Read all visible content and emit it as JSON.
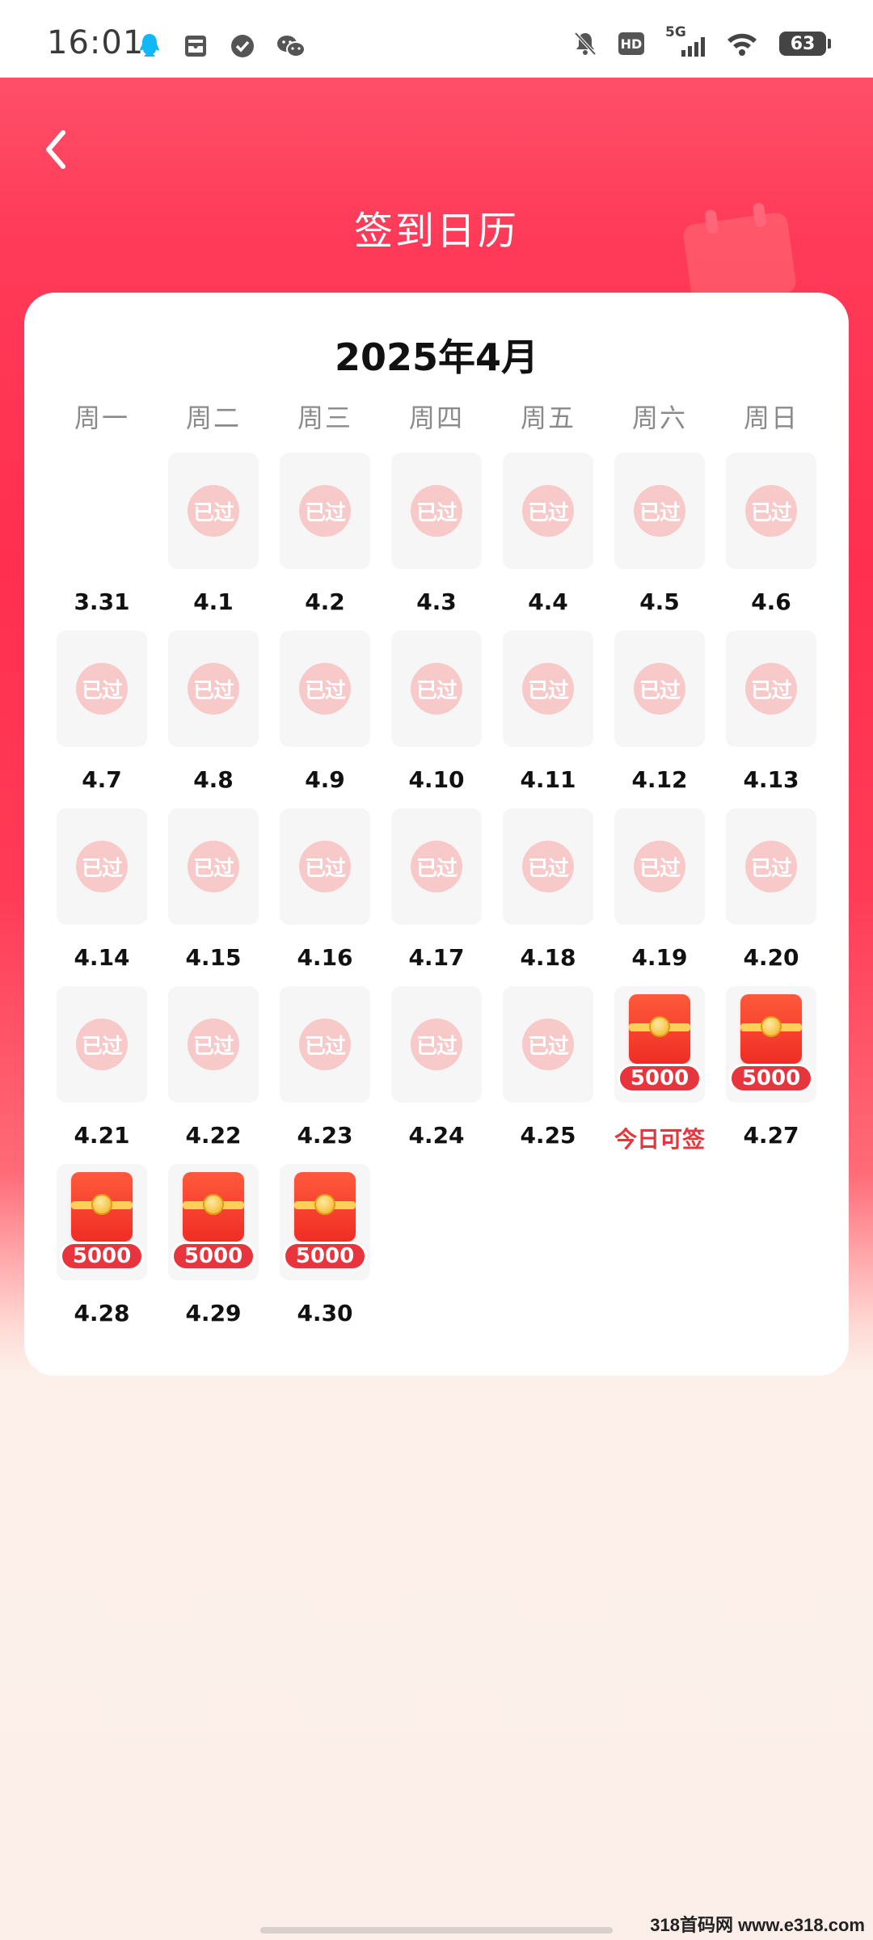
{
  "status_bar": {
    "time": "16:01",
    "left_icons": [
      "qq-icon",
      "inbox-icon",
      "check-circle-icon",
      "wechat-icon"
    ],
    "right_icons": [
      "mute-bell-icon",
      "hd-icon",
      "signal-5g-icon",
      "wifi-icon",
      "battery-icon"
    ],
    "hd_label": "HD",
    "network_label": "5G",
    "battery": "63"
  },
  "header": {
    "title": "签到日历"
  },
  "calendar": {
    "month_title": "2025年4月",
    "weekdays": [
      "周一",
      "周二",
      "周三",
      "周四",
      "周五",
      "周六",
      "周日"
    ],
    "passed_label": "已过",
    "reward_amount": "5000",
    "today_label": "今日可签",
    "weeks": [
      [
        {
          "date": "3.31",
          "state": "empty"
        },
        {
          "date": "4.1",
          "state": "passed"
        },
        {
          "date": "4.2",
          "state": "passed"
        },
        {
          "date": "4.3",
          "state": "passed"
        },
        {
          "date": "4.4",
          "state": "passed"
        },
        {
          "date": "4.5",
          "state": "passed"
        },
        {
          "date": "4.6",
          "state": "passed"
        }
      ],
      [
        {
          "date": "4.7",
          "state": "passed"
        },
        {
          "date": "4.8",
          "state": "passed"
        },
        {
          "date": "4.9",
          "state": "passed"
        },
        {
          "date": "4.10",
          "state": "passed"
        },
        {
          "date": "4.11",
          "state": "passed"
        },
        {
          "date": "4.12",
          "state": "passed"
        },
        {
          "date": "4.13",
          "state": "passed"
        }
      ],
      [
        {
          "date": "4.14",
          "state": "passed"
        },
        {
          "date": "4.15",
          "state": "passed"
        },
        {
          "date": "4.16",
          "state": "passed"
        },
        {
          "date": "4.17",
          "state": "passed"
        },
        {
          "date": "4.18",
          "state": "passed"
        },
        {
          "date": "4.19",
          "state": "passed"
        },
        {
          "date": "4.20",
          "state": "passed"
        }
      ],
      [
        {
          "date": "4.21",
          "state": "passed"
        },
        {
          "date": "4.22",
          "state": "passed"
        },
        {
          "date": "4.23",
          "state": "passed"
        },
        {
          "date": "4.24",
          "state": "passed"
        },
        {
          "date": "4.25",
          "state": "passed"
        },
        {
          "date": "今日可签",
          "state": "today"
        },
        {
          "date": "4.27",
          "state": "reward"
        }
      ],
      [
        {
          "date": "4.28",
          "state": "reward"
        },
        {
          "date": "4.29",
          "state": "reward"
        },
        {
          "date": "4.30",
          "state": "reward"
        }
      ]
    ]
  },
  "watermark": "318首码网 www.e318.com",
  "colors": {
    "brand_red": "#ff2f4f",
    "accent_red": "#e8353d",
    "stamp_pink": "#f7c9c9",
    "coin_gold": "#f2b020"
  }
}
